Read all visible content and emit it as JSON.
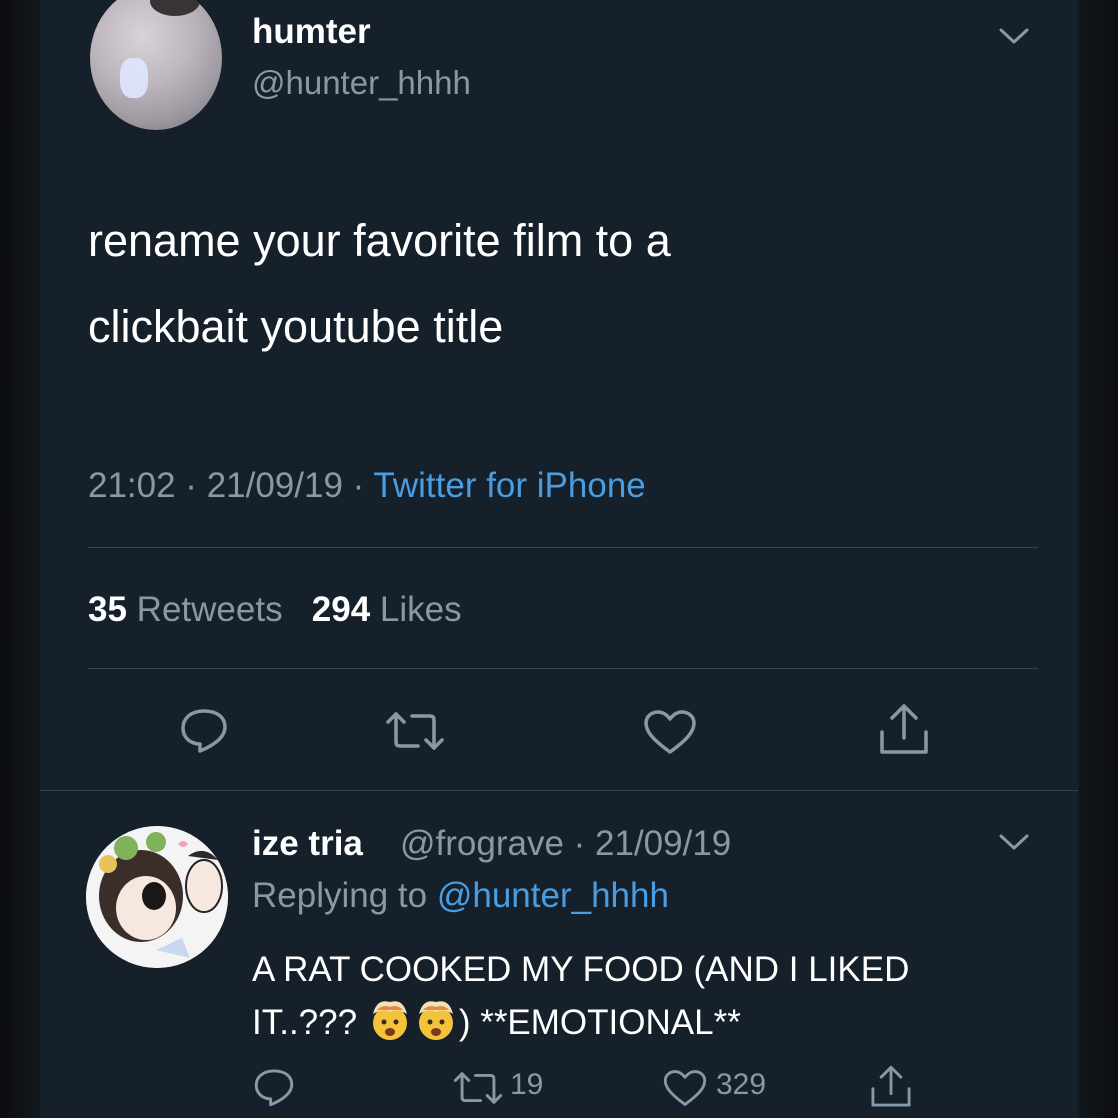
{
  "tweet": {
    "display_name": "humter",
    "handle": "@hunter_hhhh",
    "text_line1": "rename your favorite film to a",
    "text_line2": "clickbait youtube title",
    "time_date": "21:02 · 21/09/19 · ",
    "source": "Twitter for iPhone",
    "retweet_count": "35",
    "retweet_label": "Retweets",
    "like_count": "294",
    "like_label": "Likes"
  },
  "reply": {
    "display_name": "ize tria",
    "handle_date": "@frograve · 21/09/19",
    "replying_prefix": "Replying to ",
    "replying_handle": "@hunter_hhhh",
    "text_line1": "A RAT COOKED MY FOOD (AND I LIKED",
    "text_line2_a": "IT..???",
    "text_line2_b": ") **EMOTIONAL**",
    "retweet_count": "19",
    "like_count": "329"
  },
  "icons": {
    "reply": "comment-bubble-icon",
    "retweet": "retweet-arrows-icon",
    "like": "heart-icon",
    "share": "share-upload-icon",
    "menu": "chevron-down-icon",
    "emoji": "exploding-head-emoji"
  },
  "colors": {
    "background": "#15202b",
    "secondary_text": "#8899a6",
    "link": "#4a9de0",
    "divider": "#38444d"
  }
}
